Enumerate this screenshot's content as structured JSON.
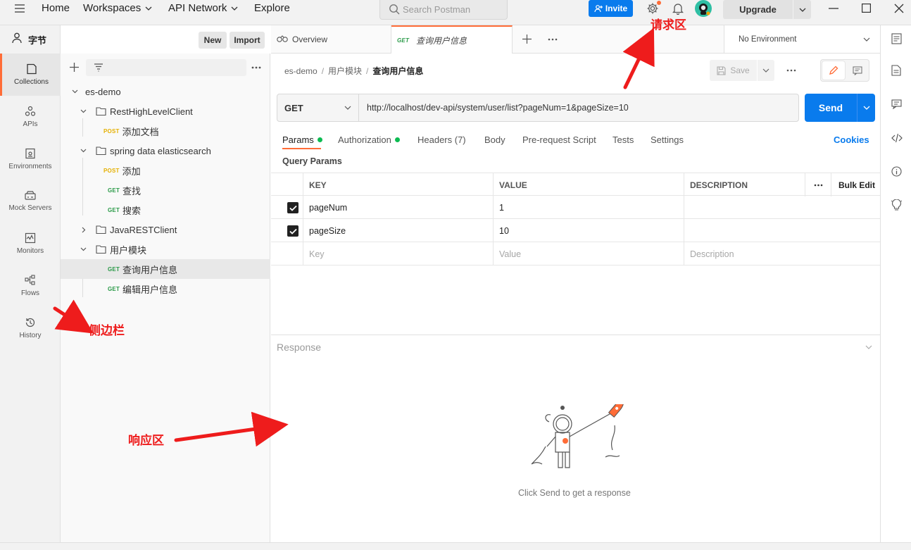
{
  "topbar": {
    "home": "Home",
    "workspaces": "Workspaces",
    "api_network": "API Network",
    "explore": "Explore",
    "search_placeholder": "Search Postman",
    "invite": "Invite",
    "upgrade": "Upgrade"
  },
  "workspace": {
    "name": "字节",
    "new_label": "New",
    "import_label": "Import"
  },
  "rail": [
    {
      "label": "Collections",
      "icon": "collections-icon"
    },
    {
      "label": "APIs",
      "icon": "apis-icon"
    },
    {
      "label": "Environments",
      "icon": "environments-icon"
    },
    {
      "label": "Mock Servers",
      "icon": "mock-servers-icon"
    },
    {
      "label": "Monitors",
      "icon": "monitors-icon"
    },
    {
      "label": "Flows",
      "icon": "flows-icon"
    },
    {
      "label": "History",
      "icon": "history-icon"
    }
  ],
  "tree": {
    "collection": "es-demo",
    "folder1": "RestHighLevelClient",
    "f1_item1": {
      "method": "POST",
      "name": "添加文档"
    },
    "folder2": "spring data elasticsearch",
    "f2_item1": {
      "method": "POST",
      "name": "添加"
    },
    "f2_item2": {
      "method": "GET",
      "name": "查找"
    },
    "f2_item3": {
      "method": "GET",
      "name": "搜索"
    },
    "folder3": "JavaRESTClient",
    "folder4": "用户模块",
    "f4_item1": {
      "method": "GET",
      "name": "查询用户信息"
    },
    "f4_item2": {
      "method": "GET",
      "name": "编辑用户信息"
    }
  },
  "tabs": {
    "overview": "Overview",
    "active_method": "GET",
    "active_name": "查询用户信息",
    "environment": "No Environment"
  },
  "breadcrumb": {
    "part1": "es-demo",
    "sep": "/",
    "part2": "用户模块",
    "part3": "查询用户信息",
    "save": "Save"
  },
  "request": {
    "method": "GET",
    "url": "http://localhost/dev-api/system/user/list?pageNum=1&pageSize=10",
    "send": "Send",
    "tabs": {
      "params": "Params",
      "authorization": "Authorization",
      "headers": "Headers (7)",
      "body": "Body",
      "prerequest": "Pre-request Script",
      "tests": "Tests",
      "settings": "Settings",
      "cookies": "Cookies"
    },
    "query_params_title": "Query Params",
    "columns": {
      "key": "KEY",
      "value": "VALUE",
      "description": "DESCRIPTION",
      "bulk_edit": "Bulk Edit"
    },
    "rows": [
      {
        "key": "pageNum",
        "value": "1"
      },
      {
        "key": "pageSize",
        "value": "10"
      }
    ],
    "placeholders": {
      "key": "Key",
      "value": "Value",
      "description": "Description"
    }
  },
  "response": {
    "title": "Response",
    "empty_message": "Click Send to get a response"
  },
  "annotations": {
    "request_area": "请求区",
    "sidebar": "侧边栏",
    "response_area": "响应区"
  },
  "colors": {
    "accent_orange": "#ff6c37",
    "send_blue": "#097bed",
    "annotation_red": "#ee1c1c",
    "get_green": "#2a9a48",
    "post_yellow": "#e5b000"
  }
}
